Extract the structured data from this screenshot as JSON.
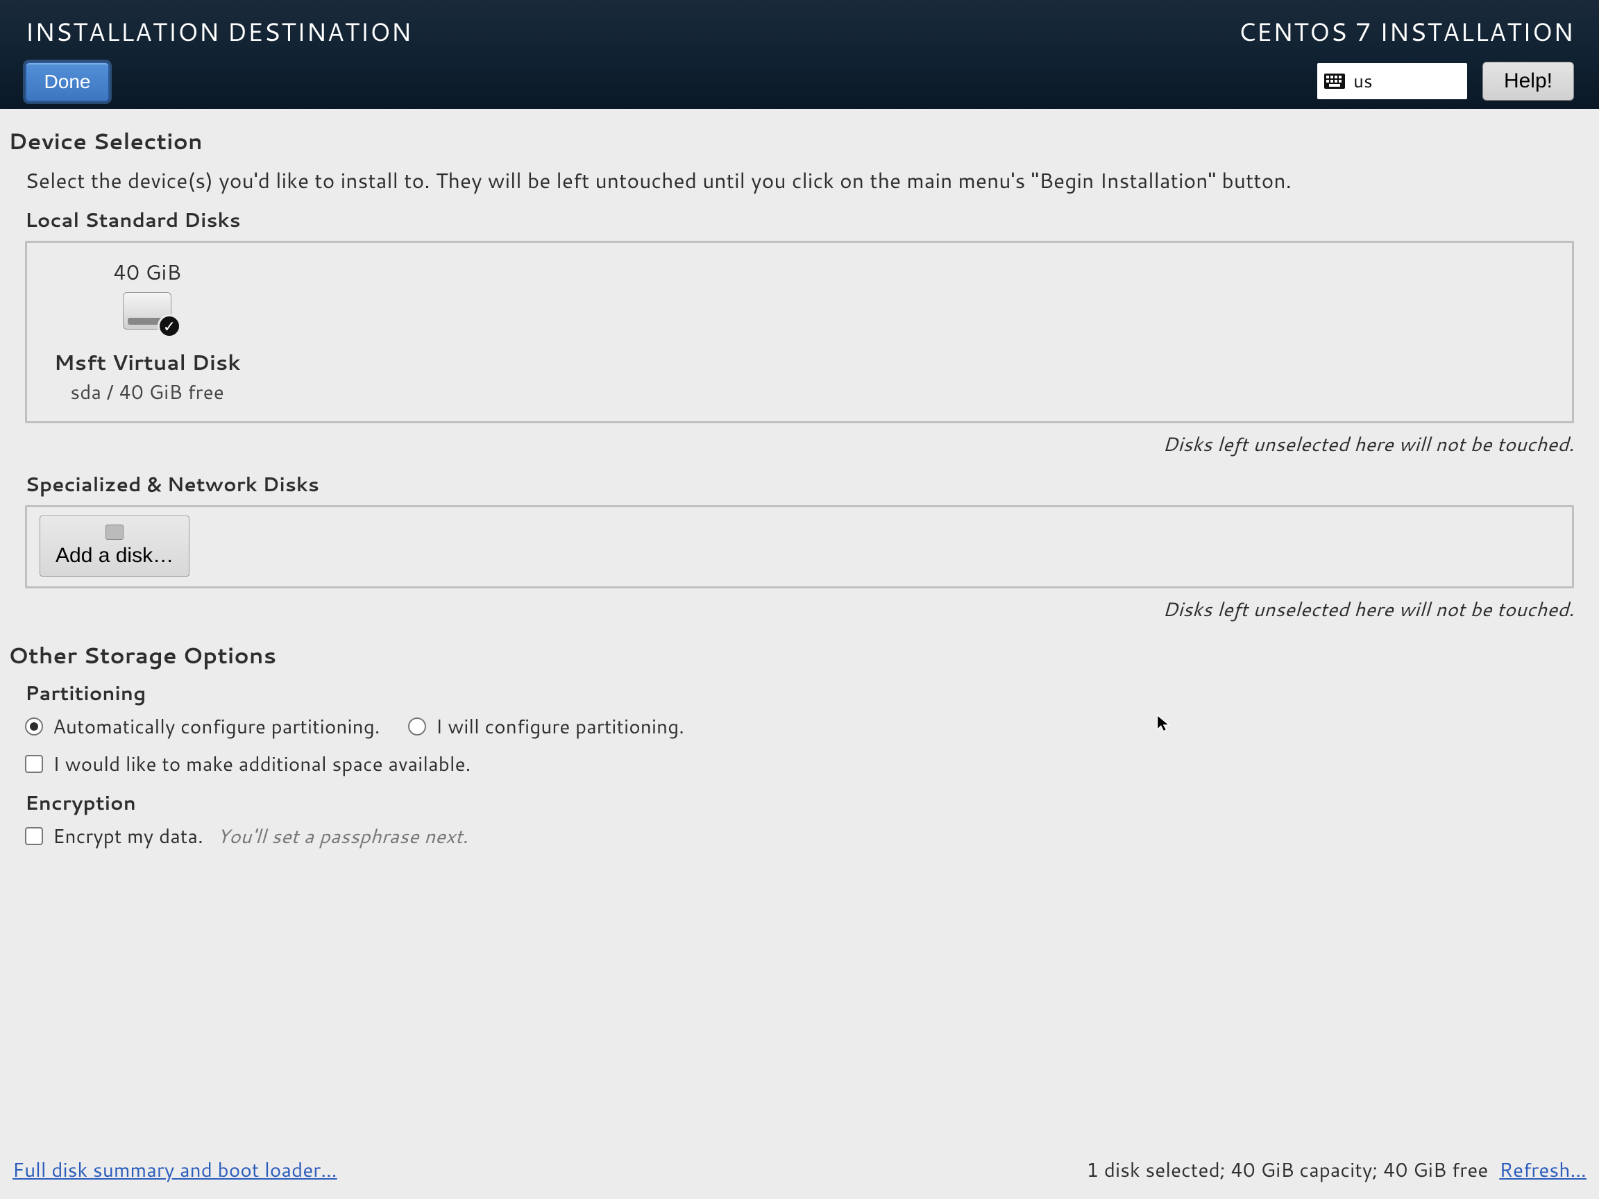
{
  "header": {
    "title": "INSTALLATION DESTINATION",
    "subtitle": "CENTOS 7 INSTALLATION",
    "done_label": "Done",
    "help_label": "Help!",
    "lang_code": "us"
  },
  "device_selection": {
    "title": "Device Selection",
    "description": "Select the device(s) you'd like to install to.  They will be left untouched until you click on the main menu's \"Begin Installation\" button.",
    "local_label": "Local Standard Disks",
    "disk": {
      "size": "40 GiB",
      "name": "Msft Virtual Disk",
      "meta": "sda  /  40 GiB free"
    },
    "note": "Disks left unselected here will not be touched.",
    "specialized_label": "Specialized & Network Disks",
    "add_disk_label": "Add a disk…"
  },
  "storage_options": {
    "title": "Other Storage Options",
    "partitioning_label": "Partitioning",
    "auto_label": "Automatically configure partitioning.",
    "manual_label": "I will configure partitioning.",
    "extra_space_label": "I would like to make additional space available.",
    "encryption_label": "Encryption",
    "encrypt_label": "Encrypt my data.",
    "encrypt_hint": "You'll set a passphrase next."
  },
  "footer": {
    "summary_link": "Full disk summary and boot loader…",
    "status": "1 disk selected; 40 GiB capacity; 40 GiB free",
    "refresh_link": "Refresh…"
  }
}
